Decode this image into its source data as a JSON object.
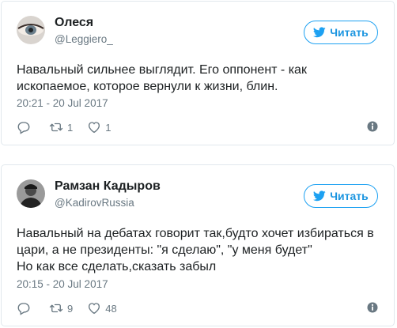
{
  "tweets": [
    {
      "name": "Олеся",
      "handle": "@Leggiero_",
      "follow_label": "Читать",
      "text": "Навальный сильнее выглядит. Его оппонент - как\nископаемое, которое вернули к жизни, блин.",
      "time": "20:21 - 20 Jul 2017",
      "replies": "",
      "retweets": "1",
      "likes": "1"
    },
    {
      "name": "Рамзан Кадыров",
      "handle": "@KadirovRussia",
      "follow_label": "Читать",
      "text": "Навальный на дебатах говорит так,будто хочет избираться в\nцари, а не президенты: \"я сделаю\", \"у меня будет\"\nНо как все сделать,сказать забыл",
      "time": "20:15 - 20 Jul 2017",
      "replies": "",
      "retweets": "9",
      "likes": "48"
    }
  ],
  "colors": {
    "accent": "#1da1f2",
    "muted": "#697882",
    "border": "#e1e8ed"
  },
  "icons": [
    "bird-icon",
    "reply-icon",
    "retweet-icon",
    "heart-icon",
    "info-icon"
  ]
}
